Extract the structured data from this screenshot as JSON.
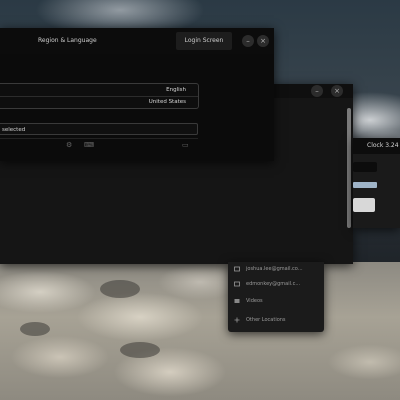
{
  "region_window": {
    "title": "Region & Language",
    "login_screen_button": "Login Screen",
    "language_value": "English",
    "formats_value": "United States",
    "selection_text": "selected"
  },
  "clock_window": {
    "title": "Clock 3.24"
  },
  "accounts_menu": {
    "items": [
      {
        "label": "joshua.lee@gmail.co...",
        "icon": "mail-icon"
      },
      {
        "label": "edmonkey@gmail.c...",
        "icon": "mail-icon"
      },
      {
        "label": "Videos",
        "icon": "video-icon"
      },
      {
        "label": "Other Locations",
        "icon": "plus-icon"
      }
    ]
  },
  "colors": {
    "window_bg": "#121212",
    "titlebar_bg": "#0c0c0c",
    "text": "#d8d8d8"
  }
}
